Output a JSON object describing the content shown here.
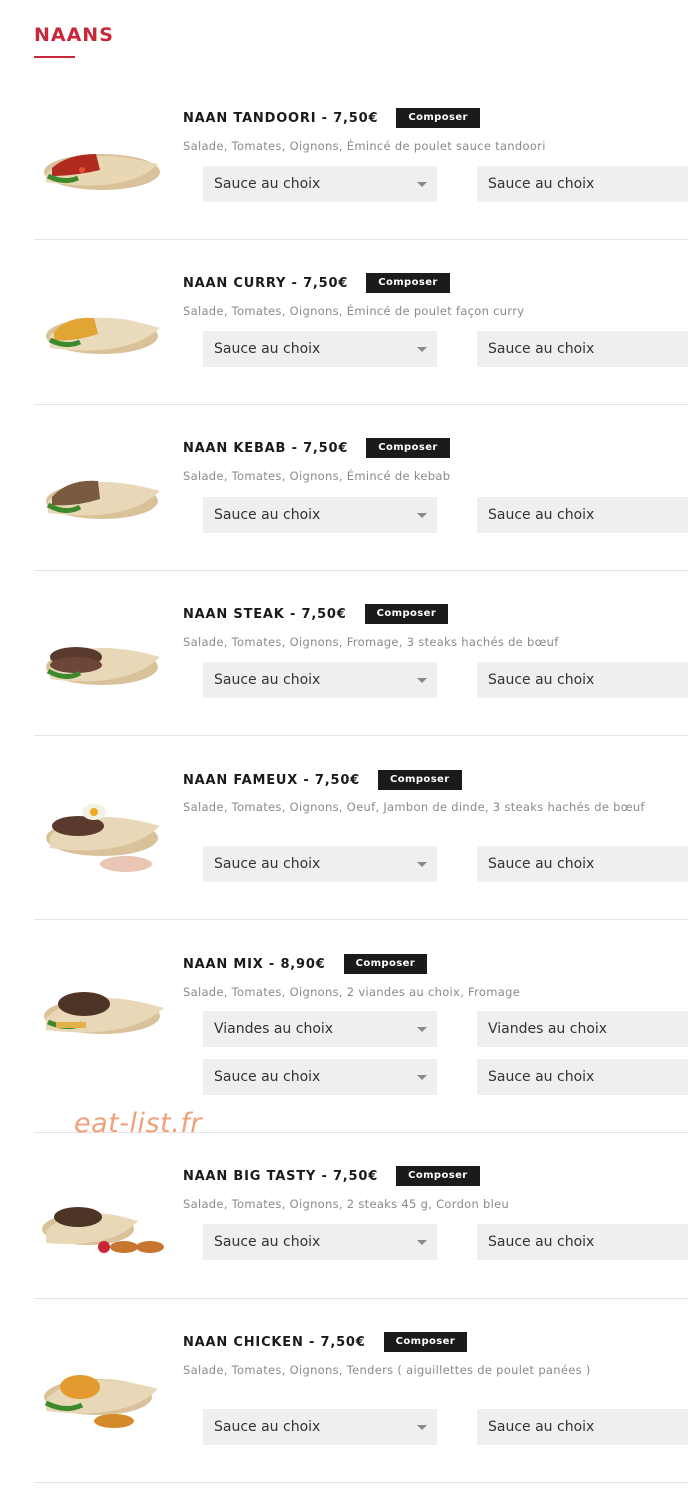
{
  "section": {
    "title": "NAANS"
  },
  "watermark": "eat-list.fr",
  "compose_label": "Composer",
  "items": [
    {
      "name": "NAAN TANDOORI - 7,50€",
      "desc": "Salade, Tomates, Oignons, Émincé de poulet sauce tandoori",
      "selects": [
        "Sauce au choix"
      ]
    },
    {
      "name": "NAAN CURRY - 7,50€",
      "desc": "Salade, Tomates, Oignons, Émincé de poulet façon curry",
      "selects": [
        "Sauce au choix"
      ]
    },
    {
      "name": "NAAN KEBAB - 7,50€",
      "desc": "Salade, Tomates, Oignons, Émincé de kebab",
      "selects": [
        "Sauce au choix"
      ]
    },
    {
      "name": "NAAN STEAK - 7,50€",
      "desc": "Salade, Tomates, Oignons, Fromage, 3 steaks hachés de bœuf",
      "selects": [
        "Sauce au choix"
      ]
    },
    {
      "name": "NAAN FAMEUX - 7,50€",
      "desc": "Salade, Tomates, Oignons, Oeuf, Jambon de dinde, 3 steaks hachés de bœuf",
      "selects": [
        "Sauce au choix"
      ]
    },
    {
      "name": "NAAN MIX - 8,90€",
      "desc": "Salade, Tomates, Oignons, 2 viandes au choix, Fromage",
      "selects": [
        "Viandes au choix",
        "Sauce au choix"
      ]
    },
    {
      "name": "NAAN BIG TASTY - 7,50€",
      "desc": "Salade, Tomates, Oignons, 2 steaks 45 g, Cordon bleu",
      "selects": [
        "Sauce au choix"
      ]
    },
    {
      "name": "NAAN CHICKEN - 7,50€",
      "desc": "Salade, Tomates, Oignons, Tenders ( aiguillettes de poulet panées )",
      "selects": [
        "Sauce au choix"
      ]
    }
  ],
  "colors": {
    "accent": "#c8283a",
    "button_bg": "#1b1b1b",
    "select_bg": "#efefef",
    "watermark": "#f0a17a"
  },
  "icons": {
    "select_caret": "chevron-down-icon",
    "thumbnail": "naan-wrap-image"
  }
}
